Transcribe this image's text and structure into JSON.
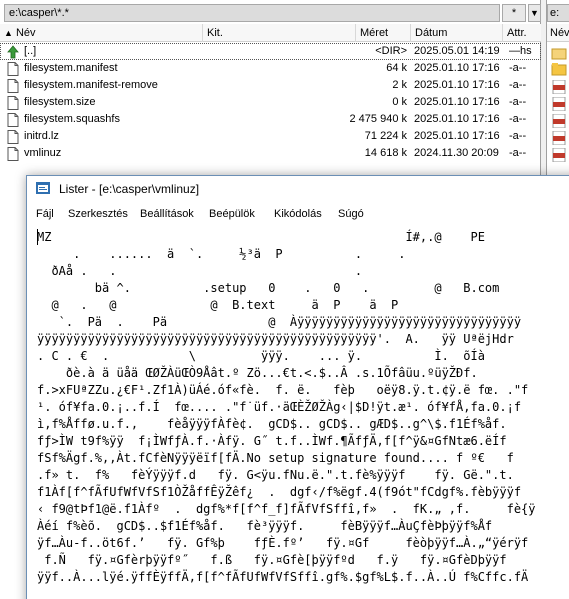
{
  "left_panel": {
    "path": "e:\\casper\\*.*",
    "star": "*",
    "dropdown": "▼",
    "columns": {
      "name": "Név",
      "ext": "Kit.",
      "size": "Méret",
      "date": "Dátum",
      "attr": "Attr."
    },
    "sort_icon": "sort-up-arrow",
    "files": [
      {
        "name": "[..]",
        "size": "<DIR>",
        "date": "2025.05.01 14:19",
        "attr": "—hs",
        "icon": "up-arrow"
      },
      {
        "name": "filesystem.manifest",
        "size": "64 k",
        "date": "2025.01.10 17:16",
        "attr": "-a--",
        "icon": "file"
      },
      {
        "name": "filesystem.manifest-remove",
        "size": "2 k",
        "date": "2025.01.10 17:16",
        "attr": "-a--",
        "icon": "file"
      },
      {
        "name": "filesystem.size",
        "size": "0 k",
        "date": "2025.01.10 17:16",
        "attr": "-a--",
        "icon": "file"
      },
      {
        "name": "filesystem.squashfs",
        "size": "2 475 940 k",
        "date": "2025.01.10 17:16",
        "attr": "-a--",
        "icon": "file"
      },
      {
        "name": "initrd.lz",
        "size": "71 224 k",
        "date": "2025.01.10 17:16",
        "attr": "-a--",
        "icon": "file"
      },
      {
        "name": "vmlinuz",
        "size": "14 618 k",
        "date": "2024.11.30 20:09",
        "attr": "-a--",
        "icon": "file"
      }
    ]
  },
  "right_panel": {
    "path": "e:",
    "column": "Név"
  },
  "lister": {
    "title": "Lister - [e:\\casper\\vmlinuz]",
    "menu": [
      "Fájl",
      "Szerkesztés",
      "Beállítások",
      "Beépülök",
      "Kikódolás",
      "Súgó"
    ],
    "content": [
      "MZ                                                 Í#,.@    PE",
      "     .    ......  ä  `.     ½³ä  P          .     .",
      "  ðAå .   .                                 .",
      "        bä ^.          .setup   0    .   0   .         @   B.com",
      "  @   .   @             @  B.text     ä  P    ä  P",
      "   `.  Pä  .    Pä              @  Àÿÿÿÿÿÿÿÿÿÿÿÿÿÿÿÿÿÿÿÿÿÿÿÿÿÿÿÿÿÿÿ",
      "ÿÿÿÿÿÿÿÿÿÿÿÿÿÿÿÿÿÿÿÿÿÿÿÿÿÿÿÿÿÿÿÿÿÿÿÿÿÿÿÿÿÿÿÿÿÿÿ'.  A.   ÿÿ UªëjHdr",
      ". C . €  .           \\         ÿÿÿ.    ... ÿ.          Ì.  õÍà",
      "    ðè.à ä üåä ŒØŽÀüŒÒ9Åât.º Zö...€t.<.$..Â .s.1Õfâüu.ºüÿŽÐf.",
      "f.>xFUªZZu.¿€F¹.Zf1À)üÁé.óf«fè.  f. ë.   fèþ   oëÿ8.ÿ.t.¢ÿ.ë fœ. .\"f",
      "¹. óf¥fa.0.¡..f.Í  fœ.... .\"f˙üf.·äŒÈŽØŽÀg‹|$D!ÿt.æ¹. óf¥fÅ,fa.0.¡f",
      "ì,f%Åffø.u.f.,    fèåÿÿÿfÀfè¢.  gCD$.. gCD$.. gÆD$..g^\\$.f1Éf%åf.",
      "fƒ>ÌW t9f%ÿÿ  f¡ÌWfƒÀ.f.·Àfÿ. G˝ t.f..ÌWf.¶ÃfƒÄ,f[f^ÿ&¤GfNtæ6.ëÍf",
      "fSf%Ägf.%,,Àt.fCfèNÿÿÿëïf[fÄ.No setup signature found.... f º€   f",
      ".f» t.  f%   fèÝÿÿÿf.d   fÿ. G<ÿu.fNu.ë.\".t.fè%ÿÿÿf    fÿ. Gë.\".t.",
      "f1Àf[f^fÃfUfWfVfSf1ÒŽåffÊÿŽêf¿  .  dgf‹/f%ëgf.4(f9ót\"fCdgf%.fèbÿÿÿf",
      "‹ f9@tÞf1@ë.f1Àfº  .  dgf%*f[f^f_f]fÃfVfSffî,f»  .  fK.„ ,f.     fè{ÿ",
      "Àéí f%èõ.  gCD$..$f1Éf%åf.   fè³ÿÿÿf.     fèBÿÿÿf…ÀuÇfèÞþÿÿf%Åf",
      "ÿf…Àu-f..öt6f.’   fÿ. Gf%þ    fƒÈ.fº’   fÿ.¤Gf     fèòþÿÿf…À.„“ÿérÿf",
      " f.Ñ   fÿ.¤Gfèrþÿÿfº˝   f.ß   fÿ.¤Gfè[þÿÿfºd   f.ÿ   fÿ.¤GfèDþÿÿf",
      "ÿÿf..À...lÿé.ÿffÈÿffÄ,f[f^fÃfUfWfVfSffî.gf%.$gf%L$.f..À..Ú f%Cffc.fÄ"
    ]
  }
}
